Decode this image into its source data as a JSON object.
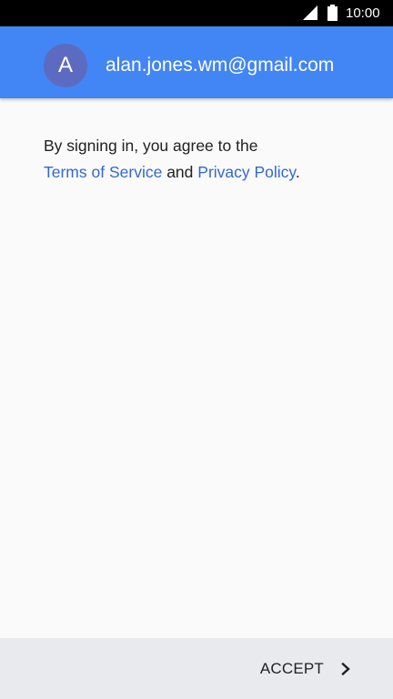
{
  "status_bar": {
    "time": "10:00",
    "icons": [
      "signal-icon",
      "battery-icon"
    ]
  },
  "account": {
    "avatar_initial": "A",
    "email": "alan.jones.wm@gmail.com",
    "header_color": "#4285f4",
    "avatar_color": "#5c6bc0"
  },
  "agreement": {
    "prefix": "By signing in, you agree to the",
    "terms_link": "Terms of Service",
    "conjunction": "and",
    "privacy_link": "Privacy Policy",
    "suffix": ".",
    "link_color": "#3367d6"
  },
  "footer": {
    "accept_label": "ACCEPT",
    "accept_icon": "chevron-right-icon"
  }
}
